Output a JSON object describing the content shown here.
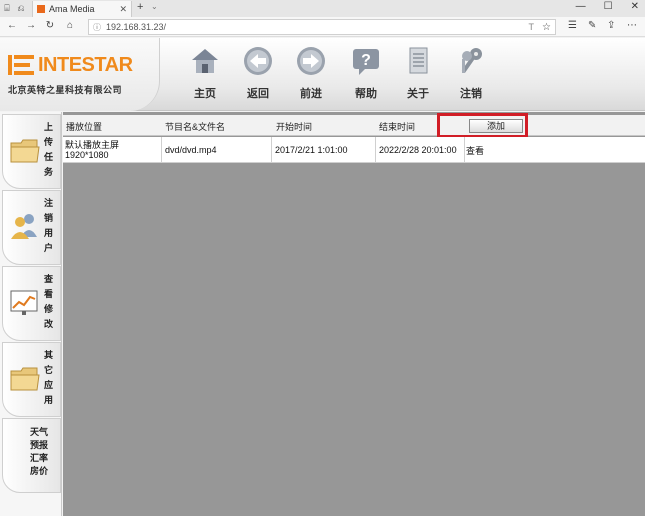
{
  "browser": {
    "tab_title": "Ama Media",
    "url": "192.168.31.23/",
    "reader_glyph": "T"
  },
  "header": {
    "logo_text": "INTESTAR",
    "company": "北京英特之星科技有限公司",
    "nav": [
      {
        "label": "主页",
        "icon": "home-icon"
      },
      {
        "label": "返回",
        "icon": "back-arrow-icon"
      },
      {
        "label": "前进",
        "icon": "forward-arrow-icon"
      },
      {
        "label": "帮助",
        "icon": "help-icon"
      },
      {
        "label": "关于",
        "icon": "document-icon"
      },
      {
        "label": "注销",
        "icon": "keys-icon"
      }
    ]
  },
  "sidebar": {
    "items": [
      {
        "label": "上传任务",
        "icon": "folder-icon"
      },
      {
        "label": "注销用户",
        "icon": "users-icon"
      },
      {
        "label": "查看修改",
        "icon": "monitor-chart-icon"
      },
      {
        "label": "其它应用",
        "icon": "folder-icon"
      },
      {
        "label": "天气预报汇率房价",
        "icon": ""
      }
    ]
  },
  "table": {
    "headers": [
      "播放位置",
      "节目名&文件名",
      "开始时间",
      "结束时间"
    ],
    "add_button": "添加",
    "rows": [
      {
        "position_line1": "默认播放主屏",
        "position_line2": "1920*1080",
        "file": "dvd/dvd.mp4",
        "start": "2017/2/21 1:01:00",
        "end": "2022/2/28 20:01:00",
        "action": "查看"
      }
    ]
  },
  "colors": {
    "logo_orange": "#f08a1c",
    "highlight_red": "#d11d26",
    "content_gray": "#979797"
  }
}
